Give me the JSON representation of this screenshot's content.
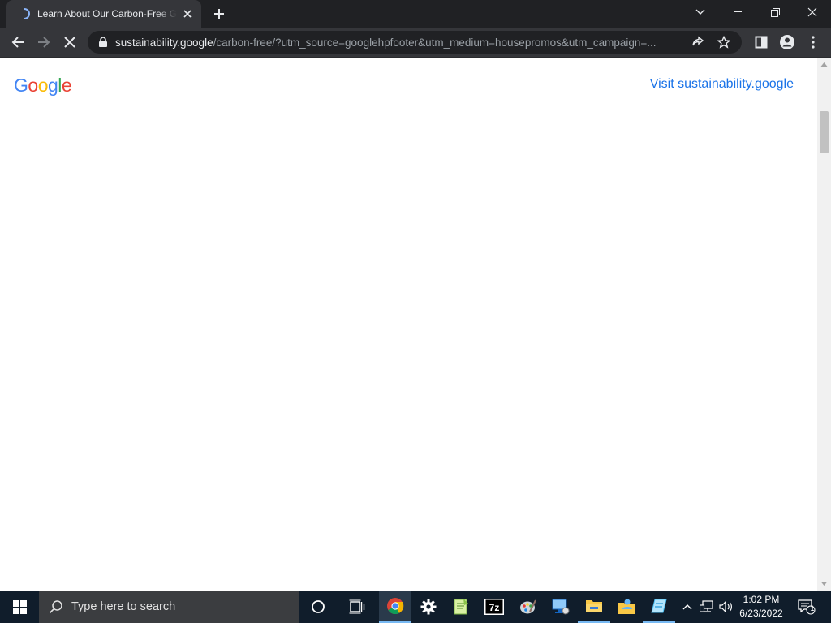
{
  "browser": {
    "tab_title": "Learn About Our Carbon-Free Goal",
    "url_host": "sustainability.google",
    "url_rest": "/carbon-free/?utm_source=googlehpfooter&utm_medium=housepromos&utm_campaign=..."
  },
  "page": {
    "logo_letters": [
      {
        "char": "G",
        "color": "#4285F4"
      },
      {
        "char": "o",
        "color": "#EA4335"
      },
      {
        "char": "o",
        "color": "#FBBC05"
      },
      {
        "char": "g",
        "color": "#4285F4"
      },
      {
        "char": "l",
        "color": "#34A853"
      },
      {
        "char": "e",
        "color": "#EA4335"
      }
    ],
    "visit_link": "Visit sustainability.google"
  },
  "taskbar": {
    "search_placeholder": "Type here to search",
    "time": "1:02 PM",
    "date": "6/23/2022",
    "notification_count": "1"
  },
  "colors": {
    "chrome_dark": "#202124",
    "chrome_toolbar": "#35363a",
    "link_blue": "#1a73e8",
    "taskbar": "#101d2b"
  }
}
